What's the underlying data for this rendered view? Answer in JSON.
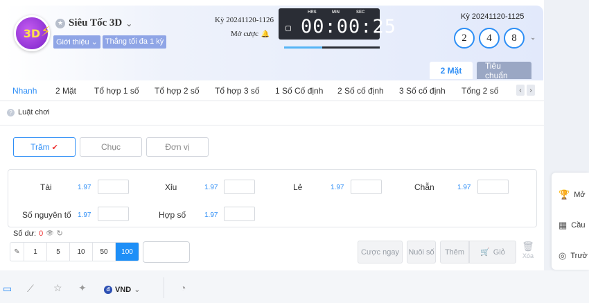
{
  "header": {
    "logo_text": "3D",
    "game_name": "Siêu Tốc 3D",
    "tags": [
      "Giới thiệu",
      "Thắng tối đa 1 kỳ"
    ],
    "current_period": "Kỳ 20241120-1126",
    "status": "Mở cược",
    "timer": {
      "labels": [
        "HRS",
        "MIN",
        "SEC"
      ],
      "value": "00:00:25",
      "progress": 0.4
    },
    "previous_period": "Kỳ 20241120-1125",
    "result_balls": [
      "2",
      "4",
      "8"
    ],
    "mode_tabs": [
      {
        "label": "2 Mặt",
        "active": true
      },
      {
        "label": "Tiêu chuẩn",
        "active": false
      }
    ]
  },
  "nav": {
    "items": [
      "Nhanh",
      "2 Mặt",
      "Tổ hợp 1 số",
      "Tổ hợp 2 số",
      "Tổ hợp 3 số",
      "1 Số Cố định",
      "2 Số cố định",
      "3 Số cố định",
      "Tổng 2 số"
    ],
    "active_index": 0
  },
  "rules_label": "Luật chơi",
  "positions": [
    {
      "label": "Trăm",
      "active": true
    },
    {
      "label": "Chục",
      "active": false
    },
    {
      "label": "Đơn vị",
      "active": false
    }
  ],
  "bet_options": [
    {
      "label": "Tài",
      "odds": "1.97"
    },
    {
      "label": "Xỉu",
      "odds": "1.97"
    },
    {
      "label": "Lẻ",
      "odds": "1.97"
    },
    {
      "label": "Chẵn",
      "odds": "1.97"
    },
    {
      "label": "Số nguyên tố",
      "odds": "1.97"
    },
    {
      "label": "Hợp số",
      "odds": "1.97"
    }
  ],
  "balance": {
    "label": "Số dư:",
    "value": "0"
  },
  "chips": {
    "values": [
      "1",
      "5",
      "10",
      "50",
      "100"
    ],
    "active_index": 4
  },
  "actions": {
    "bet_now": "Cược ngay",
    "chase": "Nuôi số",
    "add": "Thêm",
    "cart": "Giỏ",
    "delete": "Xóa"
  },
  "bottom": {
    "currency": "VND"
  },
  "side_panel": [
    "Mở",
    "Cầu",
    "Trườ"
  ]
}
